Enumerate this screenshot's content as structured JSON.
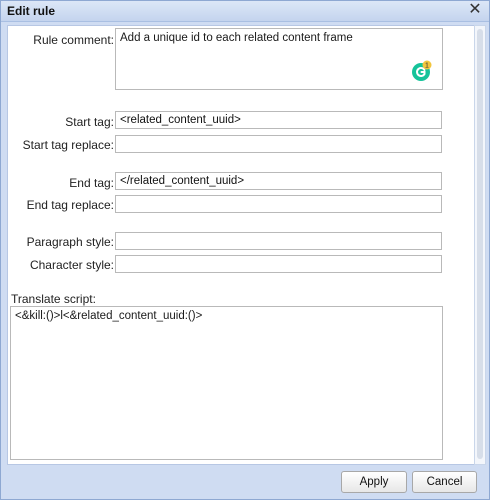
{
  "window": {
    "title": "Edit rule",
    "close_glyph": "✕"
  },
  "form": {
    "rule_comment_label": "Rule comment:",
    "rule_comment_value": "Add a unique id to each related content frame",
    "start_tag_label": "Start tag:",
    "start_tag_value": "<related_content_uuid>",
    "start_tag_replace_label": "Start tag replace:",
    "start_tag_replace_value": "",
    "end_tag_label": "End tag:",
    "end_tag_value": "</related_content_uuid>",
    "end_tag_replace_label": "End tag replace:",
    "end_tag_replace_value": "",
    "paragraph_style_label": "Paragraph style:",
    "paragraph_style_value": "",
    "character_style_label": "Character style:",
    "character_style_value": "",
    "translate_script_label": "Translate script:",
    "translate_script_value": "<&kill:()>l<&related_content_uuid:()>"
  },
  "grammarly": {
    "icon": "grammarly-icon",
    "badge_count": "1"
  },
  "buttons": {
    "apply": "Apply",
    "cancel": "Cancel"
  },
  "colors": {
    "titlebar": "#c4d4ee",
    "grammarly_green": "#15c39a",
    "badge": "#f2c53d"
  }
}
